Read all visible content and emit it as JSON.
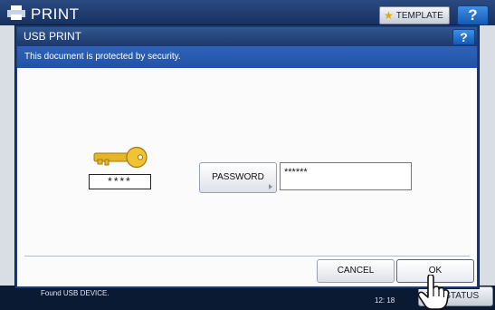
{
  "app": {
    "title": "PRINT",
    "template_label": "TEMPLATE",
    "help_label": "?",
    "status_text": "Found USB DEVICE.",
    "time_text": "12: 18",
    "job_status_label": "JOB STATUS",
    "print_icon": "printer-icon",
    "template_icon": "star-icon"
  },
  "dialog": {
    "title": "USB PRINT",
    "help_label": "?",
    "message": "This document is protected by security.",
    "key_icon": "key-icon",
    "password_mask_display": "****",
    "password_button_label": "PASSWORD",
    "password_value": "******",
    "cancel_label": "CANCEL",
    "ok_label": "OK"
  },
  "cursor": {
    "icon": "hand-pointer-icon"
  },
  "colors": {
    "header": "#17305e",
    "message_bar": "#2152a4",
    "accent_blue": "#1459b3",
    "key_gold": "#e5b52a"
  }
}
